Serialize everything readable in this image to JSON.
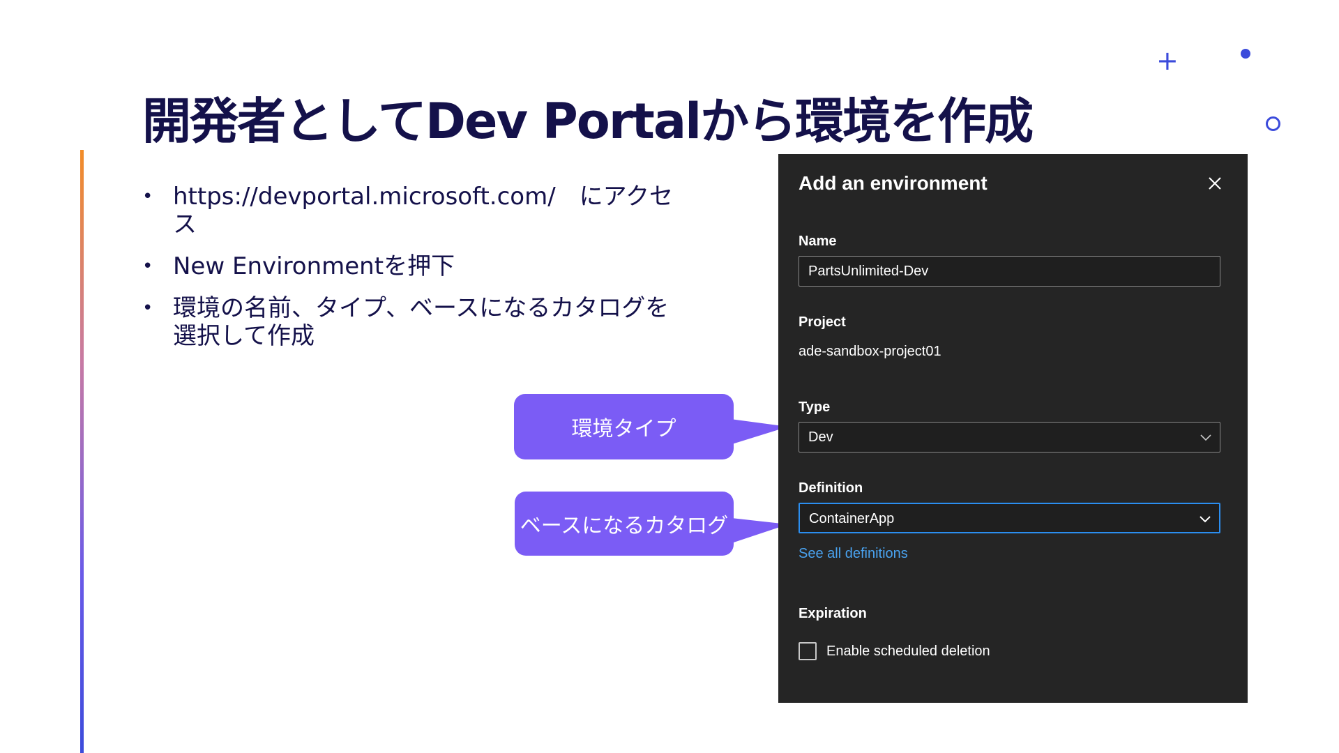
{
  "slide": {
    "title": "開発者としてDev Portalから環境を作成",
    "bullets": [
      "https://devportal.microsoft.com/　にアクセス",
      "New Environmentを押下",
      "環境の名前、タイプ、ベースになるカタログを選択して作成"
    ],
    "bullet_marker": "•",
    "decorations": {
      "plus_glyph": "+",
      "accent_color": "#3b4bdb"
    }
  },
  "callouts": {
    "type": "環境タイプ",
    "catalog": "ベースになるカタログ",
    "color": "#7b5cf5"
  },
  "dialog": {
    "title": "Add an environment",
    "close_icon": "close-icon",
    "name": {
      "label": "Name",
      "value": "PartsUnlimited-Dev"
    },
    "project": {
      "label": "Project",
      "value": "ade-sandbox-project01"
    },
    "type": {
      "label": "Type",
      "selected": "Dev"
    },
    "definition": {
      "label": "Definition",
      "selected": "ContainerApp",
      "link": "See all definitions"
    },
    "expiration": {
      "label": "Expiration",
      "checkbox_label": "Enable scheduled deletion",
      "checked": false
    },
    "colors": {
      "panel_bg": "#252525",
      "focus_border": "#2b8ef0",
      "link": "#4aa3f0"
    }
  }
}
